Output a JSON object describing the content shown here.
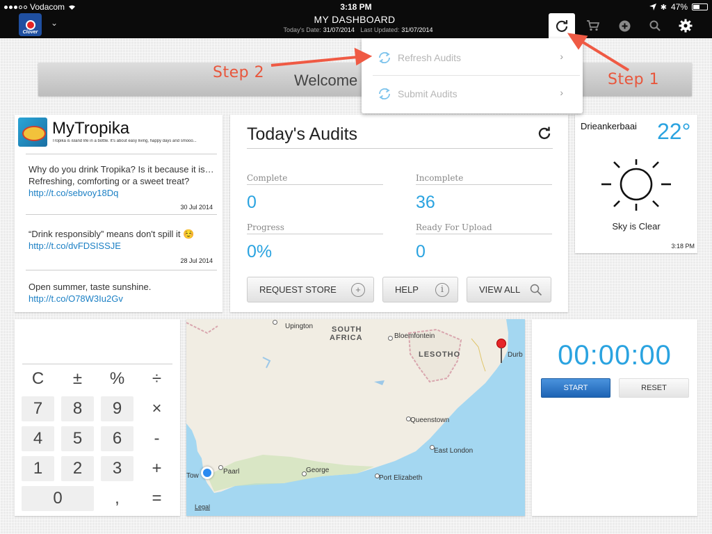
{
  "status": {
    "carrier": "Vodacom",
    "time": "3:18 PM",
    "battery": "47%"
  },
  "header": {
    "brand": "Clover",
    "title": "MY DASHBOARD",
    "todays_date_label": "Today's Date:",
    "todays_date": "31/07/2014",
    "last_updated_label": "Last Updated:",
    "last_updated": "31/07/2014"
  },
  "toolbar": {
    "icons": [
      "refresh-icon",
      "cart-icon",
      "plus-circle-icon",
      "search-icon",
      "gear-icon"
    ]
  },
  "welcome": {
    "text": "Welcome"
  },
  "dropdown": {
    "items": [
      {
        "label": "Refresh Audits"
      },
      {
        "label": "Submit Audits"
      }
    ]
  },
  "annotations": {
    "step1": "Step 1",
    "step2": "Step 2",
    "color": "#e8563c"
  },
  "tweets": {
    "account": "MyTropika",
    "tagline": "Tropika is island life in a bottle. It's about easy living, happy days and smooo...",
    "items": [
      {
        "text": "Why do you drink Tropika? Is it because it is… Refreshing, comforting or a sweet treat?",
        "link": "http://t.co/sebvoy18Dq",
        "date": "30 Jul 2014"
      },
      {
        "text": "“Drink responsibly” means don't spill it ☺️",
        "link": "http://t.co/dvFDSISSJE",
        "date": "28 Jul 2014"
      },
      {
        "text": "Open summer, taste sunshine.",
        "link": "http://t.co/O78W3Iu2Gv",
        "date": ""
      }
    ]
  },
  "audits": {
    "title": "Today's Audits",
    "stats": [
      {
        "label": "Complete",
        "value": "0"
      },
      {
        "label": "Incomplete",
        "value": "36"
      },
      {
        "label": "Progress",
        "value": "0%"
      },
      {
        "label": "Ready For Upload",
        "value": "0"
      }
    ],
    "buttons": [
      {
        "label": "REQUEST STORE",
        "icon": "plus-circle-icon"
      },
      {
        "label": "HELP",
        "icon": "info-icon"
      },
      {
        "label": "VIEW ALL",
        "icon": "search-icon"
      }
    ]
  },
  "weather": {
    "location": "Drieankerbaai",
    "temperature": "22°",
    "condition": "Sky is Clear",
    "time": "3:18 PM"
  },
  "calculator": {
    "keys": [
      "C",
      "±",
      "%",
      "÷",
      "7",
      "8",
      "9",
      "×",
      "4",
      "5",
      "6",
      "-",
      "1",
      "2",
      "3",
      "+",
      "0",
      ",",
      "="
    ]
  },
  "map": {
    "places": [
      "Upington",
      "SOUTH",
      "AFRICA",
      "Bloemfontein",
      "LESOTHO",
      "Durb",
      "Queenstown",
      "East London",
      "Paarl",
      "George",
      "Port Elizabeth",
      "Tow",
      "Legal"
    ]
  },
  "timer": {
    "display": "00:00:00",
    "start_label": "START",
    "reset_label": "RESET"
  },
  "colors": {
    "accent": "#2aa3e0",
    "annotation": "#e8563c",
    "start_button": "#1d63b4"
  }
}
